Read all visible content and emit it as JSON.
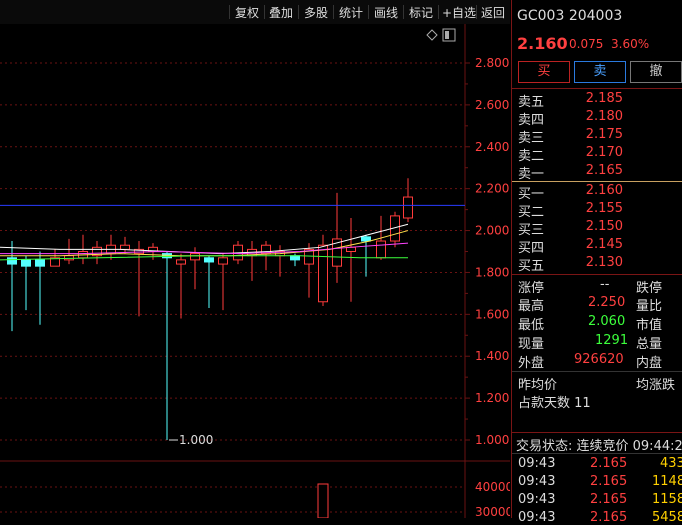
{
  "toolbar": {
    "items": [
      "复权",
      "叠加",
      "多股",
      "统计",
      "画线",
      "标记",
      "+自选",
      "返回"
    ]
  },
  "chart": {
    "y_ticks": [
      "2.800",
      "2.600",
      "2.400",
      "2.200",
      "2.000",
      "1.800",
      "1.600",
      "1.400",
      "1.200",
      "1.000"
    ],
    "min_label": "1.000",
    "vol_ticks": [
      "40000",
      "30000"
    ],
    "colors": {
      "up": "#ff3b3b",
      "down": "#54ffff",
      "ma1": "#ffffff",
      "ma2": "#ffe14b",
      "ma3": "#ff44ff",
      "ma4": "#3cff3c",
      "ma5": "#2a3cff",
      "grid": "#6a1212"
    }
  },
  "quote": {
    "code": "GC003",
    "code_num": "204003",
    "price": "2.160",
    "change": "0.075",
    "change_pct": "3.60%",
    "buttons": {
      "buy": "买",
      "sell": "卖",
      "cancel": "撤"
    }
  },
  "orderbook": {
    "asks": [
      {
        "label": "卖五",
        "price": "2.185"
      },
      {
        "label": "卖四",
        "price": "2.180"
      },
      {
        "label": "卖三",
        "price": "2.175"
      },
      {
        "label": "卖二",
        "price": "2.170"
      },
      {
        "label": "卖一",
        "price": "2.165"
      }
    ],
    "bids": [
      {
        "label": "买一",
        "price": "2.160"
      },
      {
        "label": "买二",
        "price": "2.155"
      },
      {
        "label": "买三",
        "price": "2.150"
      },
      {
        "label": "买四",
        "price": "2.145"
      },
      {
        "label": "买五",
        "price": "2.130"
      }
    ]
  },
  "stats": {
    "limit_up_label": "涨停",
    "limit_up_val": "--",
    "limit_down_label": "跌停",
    "high_label": "最高",
    "high_val": "2.250",
    "vol_ratio_label": "量比",
    "low_label": "最低",
    "low_val": "2.060",
    "mkt_val_label": "市值",
    "cur_vol_label": "现量",
    "cur_vol_val": "1291",
    "total_vol_label": "总量",
    "outer_label": "外盘",
    "outer_val": "926620",
    "inner_label": "内盘",
    "prev_avg_label": "昨均价",
    "avg_change_label": "均涨跌",
    "days_label": "占款天数 11"
  },
  "trades": {
    "status": "交易状态: 连续竞价 09:44:2",
    "rows": [
      {
        "time": "09:43",
        "price": "2.165",
        "vol": "433"
      },
      {
        "time": "09:43",
        "price": "2.165",
        "vol": "1148"
      },
      {
        "time": "09:43",
        "price": "2.165",
        "vol": "1158"
      },
      {
        "time": "09:43",
        "price": "2.165",
        "vol": "5458"
      }
    ]
  }
}
